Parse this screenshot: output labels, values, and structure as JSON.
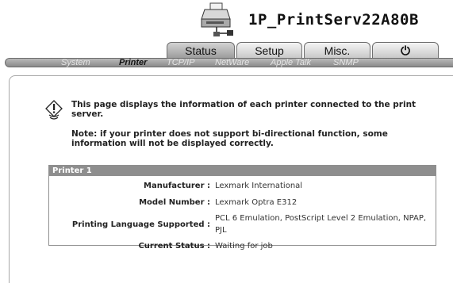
{
  "header": {
    "server_name": "1P_PrintServ22A80B",
    "icon": "printer-network-icon"
  },
  "tabs": [
    {
      "label": "Status",
      "active": true
    },
    {
      "label": "Setup",
      "active": false
    },
    {
      "label": "Misc.",
      "active": false
    },
    {
      "label": "",
      "icon": "power-icon",
      "active": false
    }
  ],
  "power_tab_glyph": "⏻",
  "subnav": [
    {
      "label": "System",
      "active": false
    },
    {
      "label": "Printer",
      "active": true
    },
    {
      "label": "TCP/IP",
      "active": false
    },
    {
      "label": "NetWare",
      "active": false
    },
    {
      "label": "Apple Talk",
      "active": false
    },
    {
      "label": "SNMP",
      "active": false
    }
  ],
  "content": {
    "info_icon": "info-bulb-icon",
    "intro": "This page displays the information of each printer connected to the print server.",
    "note": "Note: if your printer does not support bi-directional function, some information will not be displayed correctly."
  },
  "printer": {
    "title": "Printer 1",
    "rows": [
      {
        "label": "Manufacturer :",
        "value": "Lexmark International"
      },
      {
        "label": "Model Number :",
        "value": "Lexmark Optra E312"
      },
      {
        "label": "Printing Language Supported :",
        "value": "PCL 6 Emulation, PostScript Level 2 Emulation, NPAP, PJL"
      },
      {
        "label": "Current Status :",
        "value": "Waiting for job"
      }
    ]
  },
  "colors": {
    "tab_active": "#9a9a9a",
    "subnav_bar": "#8b8b8b",
    "printer_header": "#8e8e8e"
  }
}
